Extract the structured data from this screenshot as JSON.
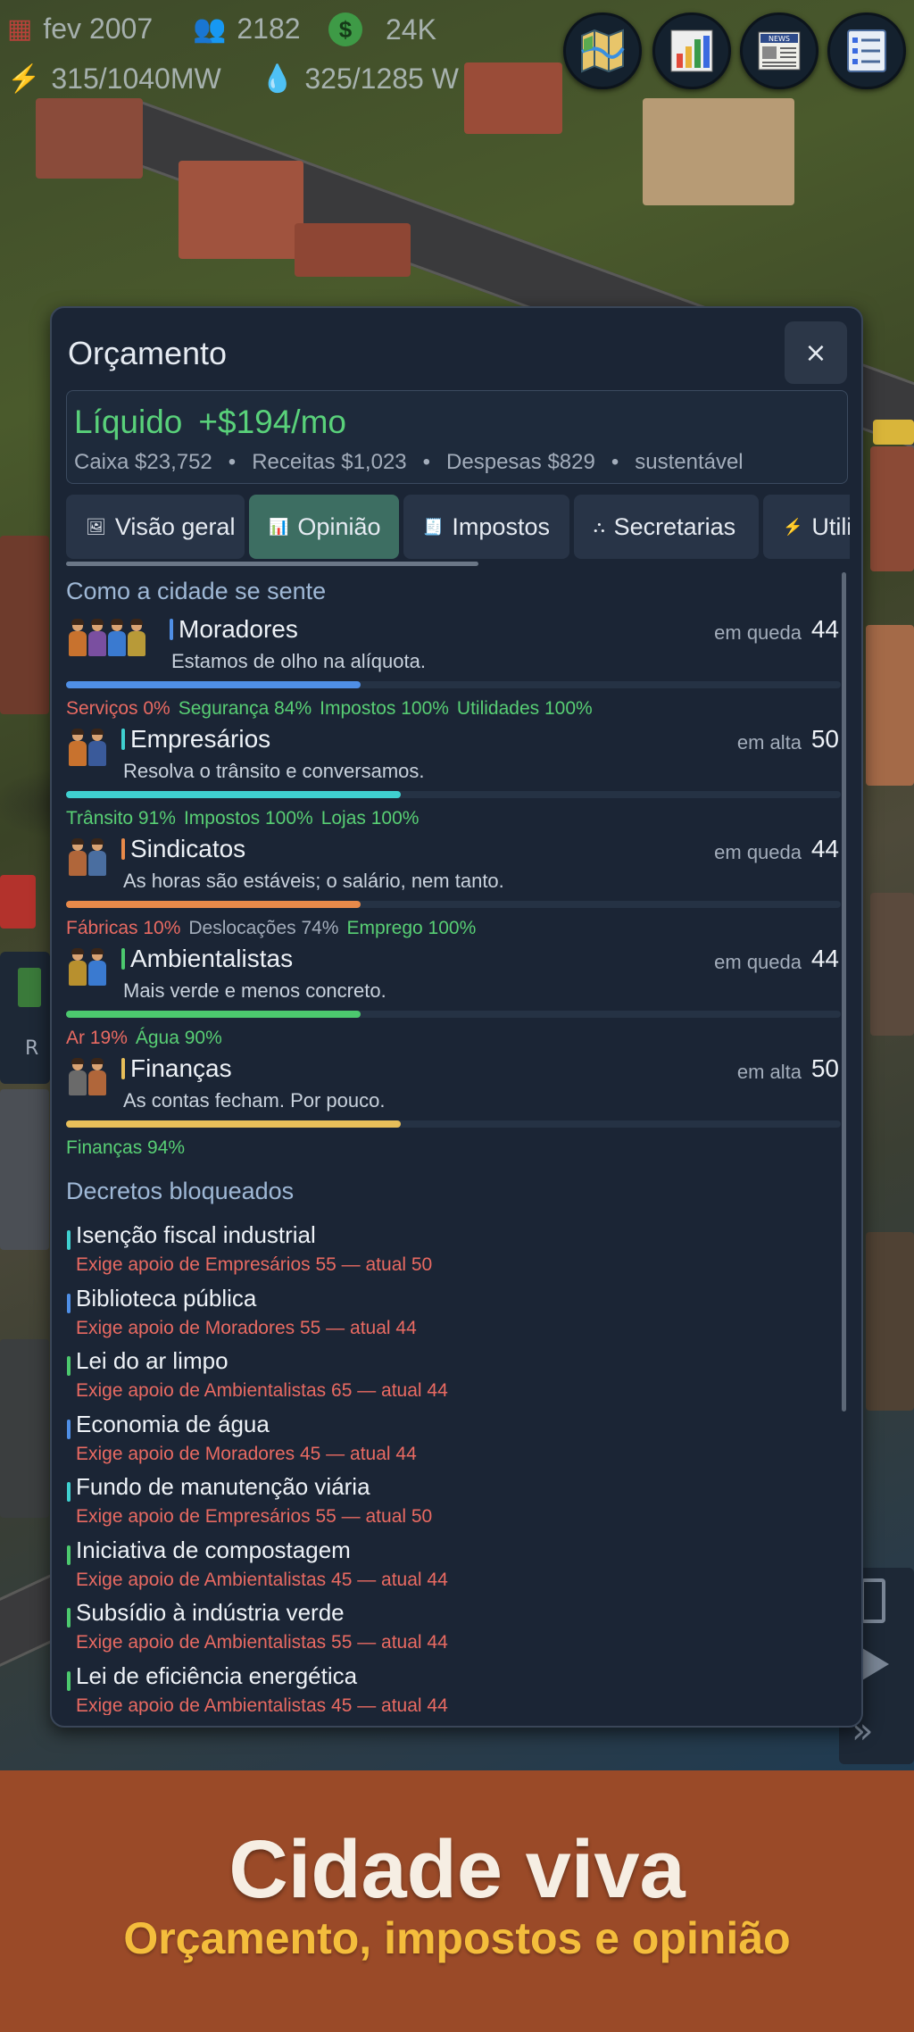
{
  "hud": {
    "date": "fev 2007",
    "population": "2182",
    "money": "24K",
    "power": "315/1040MW",
    "water": "325/1285 W",
    "icons": {
      "date": "calendar-icon",
      "population": "people-icon",
      "money": "dollar-icon",
      "power": "lightning-icon",
      "water": "water-drop-icon"
    }
  },
  "top_buttons": [
    {
      "name": "map-button",
      "icon": "map-icon"
    },
    {
      "name": "stats-button",
      "icon": "bar-chart-icon"
    },
    {
      "name": "news-button",
      "icon": "newspaper-icon",
      "text": "NEWS"
    },
    {
      "name": "menu-button",
      "icon": "list-icon"
    }
  ],
  "side_fragment": {
    "left_label": "R"
  },
  "panel": {
    "title": "Orçamento",
    "close_label": "×",
    "summary": {
      "net_label": "Líquido",
      "net_value": "+$194/mo",
      "cash": "Caixa $23,752",
      "income": "Receitas $1,023",
      "expenses": "Despesas $829",
      "status": "sustentável",
      "sep": "•"
    },
    "tabs": [
      {
        "label": "Visão geral",
        "icon": "overview-icon",
        "active": false
      },
      {
        "label": "Opinião",
        "icon": "chart-icon",
        "active": true
      },
      {
        "label": "Impostos",
        "icon": "tax-icon",
        "active": false
      },
      {
        "label": "Secretarias",
        "icon": "departments-icon",
        "active": false
      },
      {
        "label": "Utili",
        "icon": "utilities-icon",
        "active": false
      }
    ],
    "opinion_heading": "Como a cidade se sente",
    "groups": [
      {
        "name": "Moradores",
        "trend": "em queda",
        "score": "44",
        "score_value": 44,
        "quote": "Estamos de olho na alíquota.",
        "color": "#4f8fe6",
        "factors": [
          {
            "text": "Serviços 0%",
            "tone": "bad"
          },
          {
            "text": "Segurança 84%",
            "tone": "good"
          },
          {
            "text": "Impostos 100%",
            "tone": "good"
          },
          {
            "text": "Utilidades 100%",
            "tone": "good"
          }
        ]
      },
      {
        "name": "Empresários",
        "trend": "em alta",
        "score": "50",
        "score_value": 50,
        "quote": "Resolva o trânsito e conversamos.",
        "color": "#3fd0d0",
        "factors": [
          {
            "text": "Trânsito 91%",
            "tone": "good"
          },
          {
            "text": "Impostos 100%",
            "tone": "good"
          },
          {
            "text": "Lojas 100%",
            "tone": "good"
          }
        ]
      },
      {
        "name": "Sindicatos",
        "trend": "em queda",
        "score": "44",
        "score_value": 44,
        "quote": "As horas são estáveis; o salário, nem tanto.",
        "color": "#e98a4a",
        "factors": [
          {
            "text": "Fábricas 10%",
            "tone": "bad"
          },
          {
            "text": "Deslocações 74%",
            "tone": "neutral"
          },
          {
            "text": "Emprego 100%",
            "tone": "good"
          }
        ]
      },
      {
        "name": "Ambientalistas",
        "trend": "em queda",
        "score": "44",
        "score_value": 44,
        "quote": "Mais verde e menos concreto.",
        "color": "#4cc96e",
        "factors": [
          {
            "text": "Ar 19%",
            "tone": "bad"
          },
          {
            "text": "Água 90%",
            "tone": "good"
          }
        ]
      },
      {
        "name": "Finanças",
        "trend": "em alta",
        "score": "50",
        "score_value": 50,
        "quote": "As contas fecham. Por pouco.",
        "color": "#e8bf5a",
        "factors": [
          {
            "text": "Finanças 94%",
            "tone": "good"
          }
        ]
      }
    ],
    "decrees_heading": "Decretos bloqueados",
    "decrees": [
      {
        "name": "Isenção fiscal industrial",
        "requirement": "Exige apoio de Empresários 55 — atual 50",
        "color": "#3fd0d0"
      },
      {
        "name": "Biblioteca pública",
        "requirement": "Exige apoio de Moradores 55 — atual 44",
        "color": "#4f8fe6"
      },
      {
        "name": "Lei do ar limpo",
        "requirement": "Exige apoio de Ambientalistas 65 — atual 44",
        "color": "#4cc96e"
      },
      {
        "name": "Economia de água",
        "requirement": "Exige apoio de Moradores 45 — atual 44",
        "color": "#4f8fe6"
      },
      {
        "name": "Fundo de manutenção viária",
        "requirement": "Exige apoio de Empresários 55 — atual 50",
        "color": "#3fd0d0"
      },
      {
        "name": "Iniciativa de compostagem",
        "requirement": "Exige apoio de Ambientalistas 45 — atual 44",
        "color": "#4cc96e"
      },
      {
        "name": "Subsídio à indústria verde",
        "requirement": "Exige apoio de Ambientalistas 55 — atual 44",
        "color": "#4cc96e"
      },
      {
        "name": "Lei de eficiência energética",
        "requirement": "Exige apoio de Ambientalistas 45 — atual 44",
        "color": "#4cc96e"
      }
    ]
  },
  "banner": {
    "title": "Cidade viva",
    "subtitle": "Orçamento, impostos e opinião"
  },
  "colors": {
    "good": "#58cf74",
    "bad": "#e96a62",
    "neutral": "#a3adbb",
    "accent_tab": "#3d6e62",
    "banner": "#9a4a28"
  }
}
